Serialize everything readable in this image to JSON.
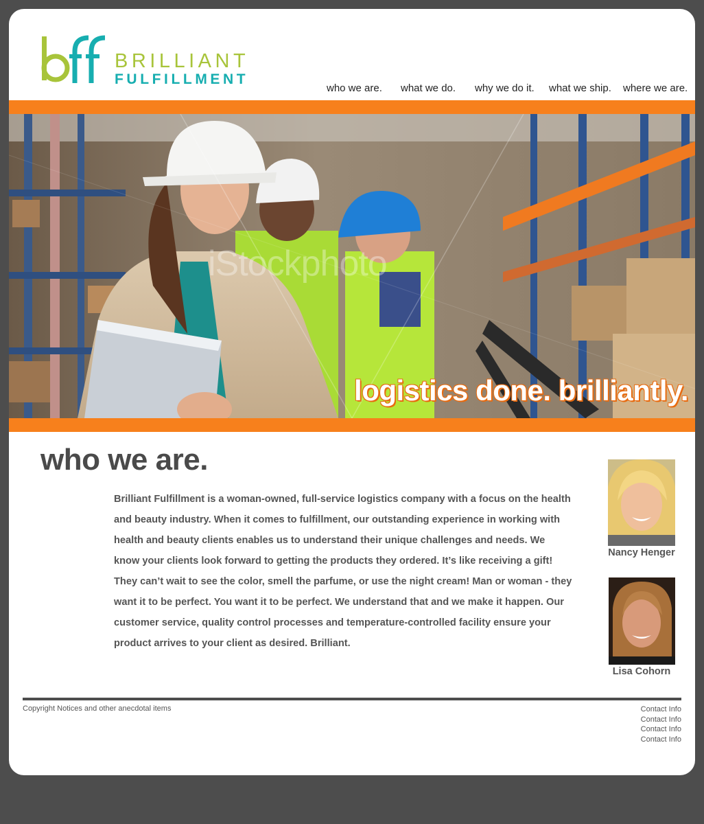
{
  "brand": {
    "logo_mark": "bff",
    "name_line1": "BRILLIANT",
    "name_line2": "FULFILLMENT",
    "colors": {
      "green": "#a8c43a",
      "teal": "#17aeb0",
      "orange": "#f7801c",
      "dark": "#4d4d4d"
    }
  },
  "nav": {
    "items": [
      {
        "label": "who we are."
      },
      {
        "label": "what we do."
      },
      {
        "label": "why we do it."
      },
      {
        "label": "what we ship."
      },
      {
        "label": "where we are."
      }
    ]
  },
  "hero": {
    "tagline": "logistics done. brilliantly.",
    "watermark": "iStockphoto"
  },
  "main": {
    "title": "who we are.",
    "body": "Brilliant Fulfillment is a woman-owned, full-service logistics company with a focus on the health and beauty industry. When it comes to fulfillment, our outstanding experience in working with health and beauty clients enables us to understand their unique challenges and needs. We know your clients look forward to getting the products they ordered. It’s like receiving a gift! They can’t wait to see the color, smell the parfume, or use the night cream! Man or woman - they want it to be perfect. You want it to be perfect. We understand that and we make it happen. Our customer service, quality control processes and temperature-controlled facility ensure your product arrives to your client as desired. Brilliant."
  },
  "people": [
    {
      "name": "Nancy Henger"
    },
    {
      "name": "Lisa Cohorn"
    }
  ],
  "footer": {
    "copyright": "Copyright Notices and other anecdotal items",
    "contacts": [
      "Contact Info",
      "Contact Info",
      "Contact Info",
      "Contact Info"
    ]
  }
}
